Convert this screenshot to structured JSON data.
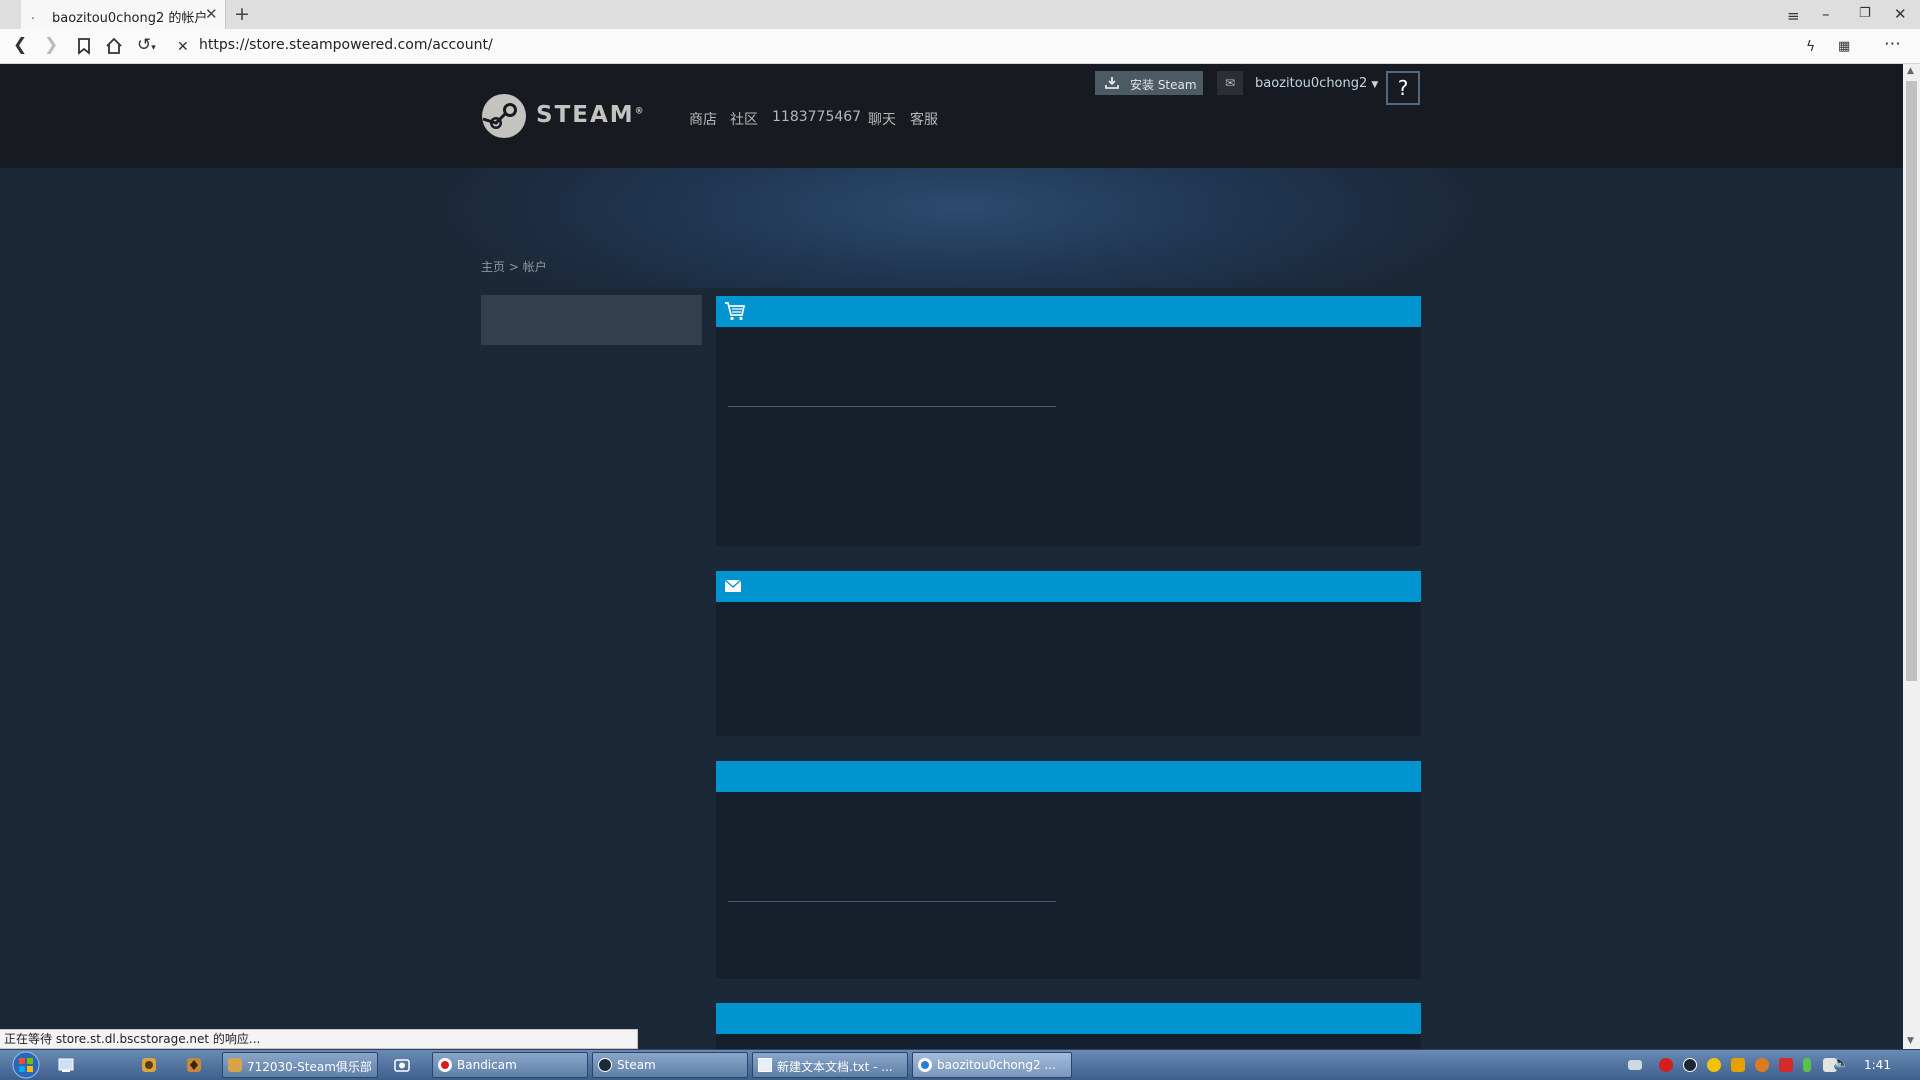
{
  "browser": {
    "tab_title": "baozitou0chong2 的帐户",
    "tab_favicon": ".",
    "url": "https://store.steampowered.com/account/",
    "status_text": "正在等待 store.st.dl.bscstorage.net 的响应..."
  },
  "steam": {
    "logo_text": "STEAM",
    "logo_mark": "®",
    "nav": [
      "商店",
      "社区",
      "1183775467",
      "聊天",
      "客服"
    ],
    "install_label": "安装 Steam",
    "account_name": "baozitou0chong2",
    "help_label": "?",
    "breadcrumb": {
      "home": "主页",
      "separator": ">",
      "current": "帐户"
    }
  },
  "panels": [
    {
      "icon": "cart-icon"
    },
    {
      "icon": "envelope-icon"
    },
    {
      "icon": ""
    },
    {
      "icon": ""
    }
  ],
  "taskbar": {
    "items": [
      {
        "label": "712030-Steam俱乐部"
      },
      {
        "label": "Bandicam"
      },
      {
        "label": "Steam"
      },
      {
        "label": "新建文本文档.txt - ..."
      },
      {
        "label": "baozitou0chong2 ..."
      }
    ],
    "clock": "1:41"
  },
  "colors": {
    "steam_header": "#171a21",
    "page_bg": "#1b2838",
    "panel_header": "#0094d1",
    "panel_body": "#16202d"
  }
}
